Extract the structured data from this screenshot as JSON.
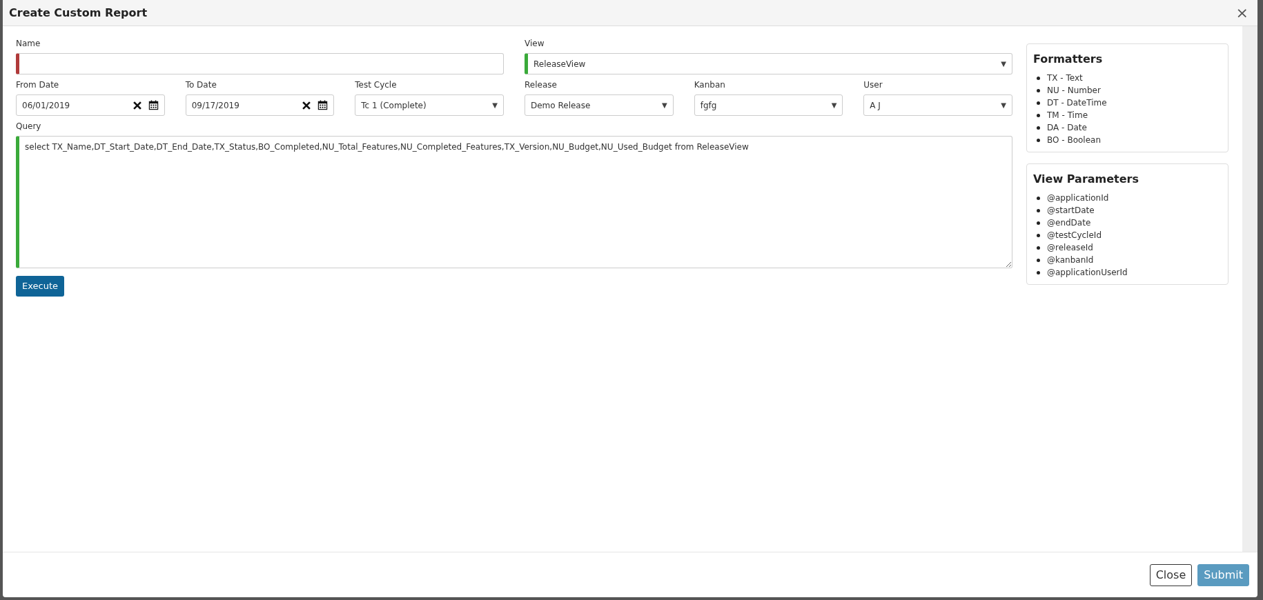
{
  "dialog": {
    "title": "Create Custom Report",
    "close_glyph": "×"
  },
  "name_field": {
    "label": "Name",
    "valid": false
  },
  "view_field": {
    "label": "View",
    "value": "ReleaseView",
    "caret": "▼",
    "valid": true
  },
  "filters": [
    {
      "kind": "date",
      "label": "From Date",
      "value": "06/01/2019"
    },
    {
      "kind": "date",
      "label": "To Date",
      "value": "09/17/2019"
    },
    {
      "kind": "select",
      "label": "Test Cycle",
      "value": "Tc 1 (Complete)",
      "caret": "▼"
    },
    {
      "kind": "select",
      "label": "Release",
      "value": "Demo Release",
      "caret": "▼"
    },
    {
      "kind": "select",
      "label": "Kanban",
      "value": "fgfg",
      "caret": "▼"
    },
    {
      "kind": "select",
      "label": "User",
      "value": "A J",
      "caret": "▼"
    }
  ],
  "query": {
    "label": "Query",
    "value": "select TX_Name,DT_Start_Date,DT_End_Date,TX_Status,BO_Completed,NU_Total_Features,NU_Completed_Features,TX_Version,NU_Budget,NU_Used_Budget from ReleaseView",
    "valid": true
  },
  "execute_button": "Execute",
  "panels": [
    {
      "title": "Formatters",
      "items": [
        "TX - Text",
        "NU - Number",
        "DT - DateTime",
        "TM - Time",
        "DA - Date",
        "BO - Boolean"
      ]
    },
    {
      "title": "View Parameters",
      "items": [
        "@applicationId",
        "@startDate",
        "@endDate",
        "@testCycleId",
        "@releaseId",
        "@kanbanId",
        "@applicationUserId"
      ]
    }
  ],
  "footer": {
    "buttons": [
      {
        "label": "Close",
        "kind": "outline",
        "disabled": false
      },
      {
        "label": "Submit",
        "kind": "primary",
        "disabled": true
      }
    ]
  }
}
